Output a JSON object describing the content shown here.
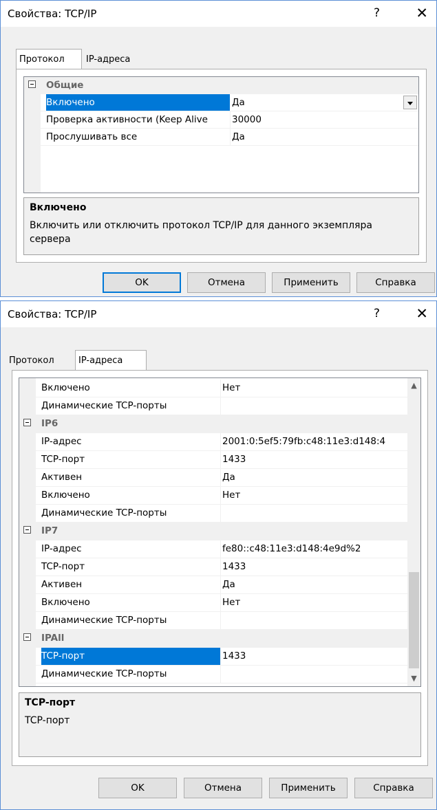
{
  "dialog1": {
    "title": "Свойства: TCP/IP",
    "help_glyph": "?",
    "close_glyph": "✕",
    "tabs": [
      {
        "label": "Протокол"
      },
      {
        "label": "IP-адреса"
      }
    ],
    "category": "Общие",
    "rows": [
      {
        "name": "Включено",
        "value": "Да"
      },
      {
        "name": "Проверка активности (Keep Alive",
        "value": "30000"
      },
      {
        "name": "Прослушивать все",
        "value": "Да"
      }
    ],
    "description_title": "Включено",
    "description_text": "Включить или отключить протокол TCP/IP для данного экземпляра сервера",
    "buttons": {
      "ok": "OK",
      "cancel": "Отмена",
      "apply": "Применить",
      "help": "Справка"
    }
  },
  "dialog2": {
    "title": "Свойства: TCP/IP",
    "help_glyph": "?",
    "close_glyph": "✕",
    "tabs": [
      {
        "label": "Протокол"
      },
      {
        "label": "IP-адреса"
      }
    ],
    "rows": [
      {
        "type": "prop",
        "name": "Включено",
        "value": "Нет"
      },
      {
        "type": "prop",
        "name": "Динамические TCP-порты",
        "value": ""
      },
      {
        "type": "cat",
        "name": "IP6"
      },
      {
        "type": "prop",
        "name": "IP-адрес",
        "value": "2001:0:5ef5:79fb:c48:11e3:d148:4"
      },
      {
        "type": "prop",
        "name": "TCP-порт",
        "value": "1433"
      },
      {
        "type": "prop",
        "name": "Активен",
        "value": "Да"
      },
      {
        "type": "prop",
        "name": "Включено",
        "value": "Нет"
      },
      {
        "type": "prop",
        "name": "Динамические TCP-порты",
        "value": ""
      },
      {
        "type": "cat",
        "name": "IP7"
      },
      {
        "type": "prop",
        "name": "IP-адрес",
        "value": "fe80::c48:11e3:d148:4e9d%2"
      },
      {
        "type": "prop",
        "name": "TCP-порт",
        "value": "1433"
      },
      {
        "type": "prop",
        "name": "Активен",
        "value": "Да"
      },
      {
        "type": "prop",
        "name": "Включено",
        "value": "Нет"
      },
      {
        "type": "prop",
        "name": "Динамические TCP-порты",
        "value": ""
      },
      {
        "type": "cat",
        "name": "IPAll"
      },
      {
        "type": "sel",
        "name": "TCP-порт",
        "value": "1433"
      },
      {
        "type": "prop",
        "name": "Динамические TCP-порты",
        "value": ""
      }
    ],
    "description_title": "TCP-порт",
    "description_text": "TCP-порт",
    "buttons": {
      "ok": "OK",
      "cancel": "Отмена",
      "apply": "Применить",
      "help": "Справка"
    }
  }
}
